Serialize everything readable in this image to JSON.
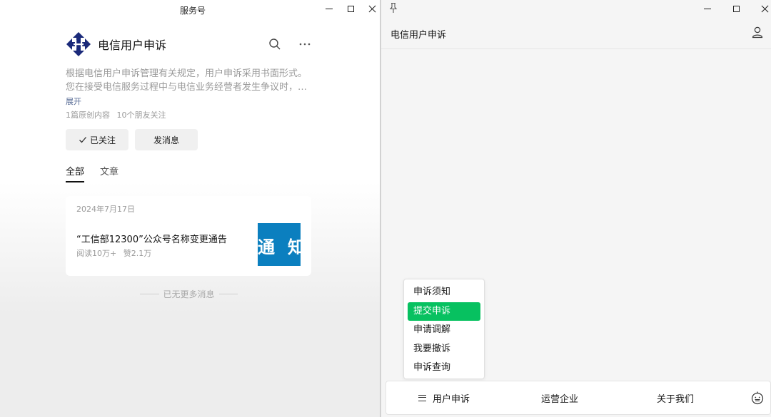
{
  "left_window": {
    "title": "服务号",
    "account": {
      "name": "电信用户申诉",
      "description_lines": [
        "根据电信用户申诉管理有关规定，用户申诉采用书面形式。",
        "您在接受电信服务过程中与电信业务经营者发生争议时，…"
      ],
      "expand_label": "展开",
      "original_count": "1篇原创内容",
      "friends_following": "10个朋友关注"
    },
    "buttons": {
      "followed_label": "已关注",
      "message_label": "发消息"
    },
    "tabs": [
      {
        "label": "全部",
        "active": true
      },
      {
        "label": "文章",
        "active": false
      }
    ],
    "article": {
      "date": "2024年7月17日",
      "title": "“工信部12300”公众号名称变更通告",
      "reads": "阅读10万+",
      "likes": "赞2.1万",
      "thumb_text_1": "通",
      "thumb_text_2": "知"
    },
    "no_more_text": "已无更多消息"
  },
  "right_window": {
    "chat_title": "电信用户申诉",
    "popup_menu": [
      {
        "label": "申诉须知",
        "selected": false
      },
      {
        "label": "提交申诉",
        "selected": true
      },
      {
        "label": "申请调解",
        "selected": false
      },
      {
        "label": "我要撤诉",
        "selected": false
      },
      {
        "label": "申诉查询",
        "selected": false
      }
    ],
    "bottom_menu": [
      {
        "label": "用户申诉"
      },
      {
        "label": "运营企业"
      },
      {
        "label": "关于我们"
      }
    ]
  },
  "colors": {
    "accent_green": "#07c160",
    "link_blue": "#576b95",
    "thumb_blue": "#0b7fbf",
    "logo_navy": "#1b2a7a"
  },
  "icons": {
    "title_bar": [
      "minimize-icon",
      "maximize-icon",
      "close-icon"
    ],
    "account_header": [
      "search-icon",
      "more-icon"
    ],
    "right_header": [
      "pin-icon",
      "user-icon"
    ],
    "bottom_bar": [
      "menu-icon",
      "emoji-icon"
    ]
  }
}
